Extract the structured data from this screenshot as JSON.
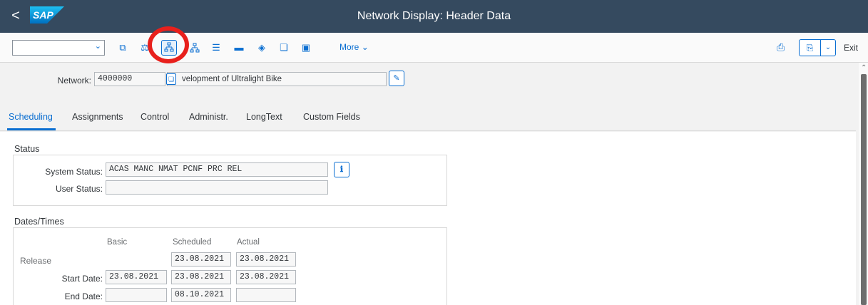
{
  "shell": {
    "title": "Network Display: Header Data",
    "back_glyph": "<",
    "logo_text": "SAP"
  },
  "toolbar": {
    "command_field_value": "",
    "more_label": "More",
    "exit_label": "Exit",
    "icons": [
      "copy-icon",
      "balance-icon",
      "hierarchy-icon",
      "network-structure-icon",
      "list-align-icon",
      "minus-bar-icon",
      "cube-icon",
      "copy-pages-icon",
      "image-icon",
      "print-icon",
      "layout-icon"
    ]
  },
  "header": {
    "network_label": "Network:",
    "network_value": "4000000",
    "network_description": "velopment of Ultralight Bike"
  },
  "tabs": [
    {
      "label": "Scheduling",
      "selected": true
    },
    {
      "label": "Assignments",
      "selected": false
    },
    {
      "label": "Control",
      "selected": false
    },
    {
      "label": "Administr.",
      "selected": false
    },
    {
      "label": "LongText",
      "selected": false
    },
    {
      "label": "Custom Fields",
      "selected": false
    }
  ],
  "status": {
    "title": "Status",
    "system_status_label": "System Status:",
    "system_status_value": "ACAS MANC NMAT PCNF PRC  REL",
    "user_status_label": "User Status:",
    "user_status_value": ""
  },
  "dates": {
    "title": "Dates/Times",
    "columns": [
      "Basic",
      "Scheduled",
      "Actual"
    ],
    "rows": [
      {
        "label": "Release",
        "basic": null,
        "scheduled": "23.08.2021",
        "actual": "23.08.2021"
      },
      {
        "label": "Start Date:",
        "basic": "23.08.2021",
        "scheduled": "23.08.2021",
        "actual": "23.08.2021"
      },
      {
        "label": "End Date:",
        "basic": "",
        "scheduled": "08.10.2021",
        "actual": ""
      }
    ]
  },
  "colors": {
    "shell_bg": "#354a5f",
    "accent": "#0a6ed1",
    "highlight_ring": "#e8201c"
  }
}
